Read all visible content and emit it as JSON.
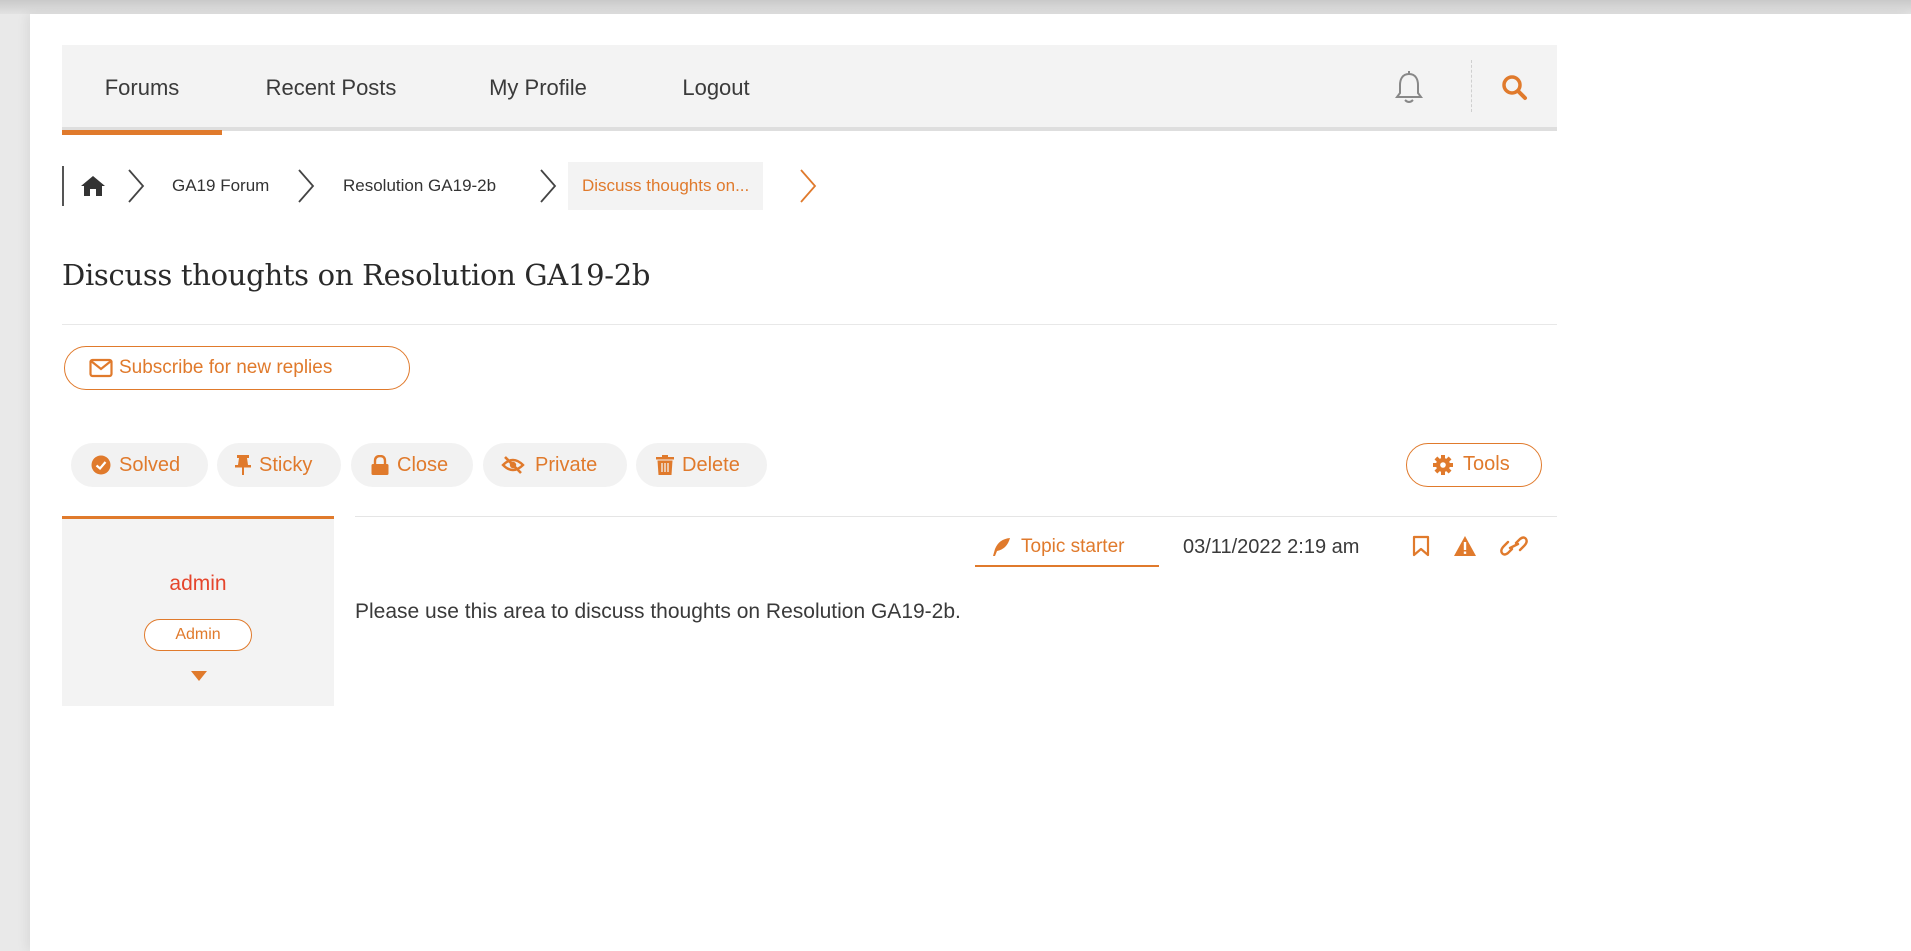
{
  "nav": {
    "items": [
      {
        "label": "Forums",
        "active": true
      },
      {
        "label": "Recent Posts"
      },
      {
        "label": "My Profile"
      },
      {
        "label": "Logout"
      }
    ],
    "icons": [
      "bell-icon",
      "search-icon"
    ]
  },
  "breadcrumb": {
    "home_icon": "home-icon",
    "items": [
      "GA19 Forum",
      "Resolution GA19-2b",
      "Discuss thoughts on..."
    ]
  },
  "topic": {
    "title": "Discuss thoughts on Resolution GA19-2b",
    "subscribe_label": "Subscribe for new replies"
  },
  "actions": {
    "solved": "Solved",
    "sticky": "Sticky",
    "close": "Close",
    "private": "Private",
    "delete": "Delete",
    "tools": "Tools"
  },
  "post": {
    "author": "admin",
    "role": "Admin",
    "badge": "Topic starter",
    "date": "03/11/2022 2:19 am",
    "body": "Please use this area to discuss thoughts on Resolution GA19-2b.",
    "icons": [
      "bookmark-icon",
      "report-icon",
      "link-icon"
    ]
  },
  "colors": {
    "accent": "#e07a2c",
    "author": "#e5452c",
    "nav_bg": "#f3f3f3"
  }
}
